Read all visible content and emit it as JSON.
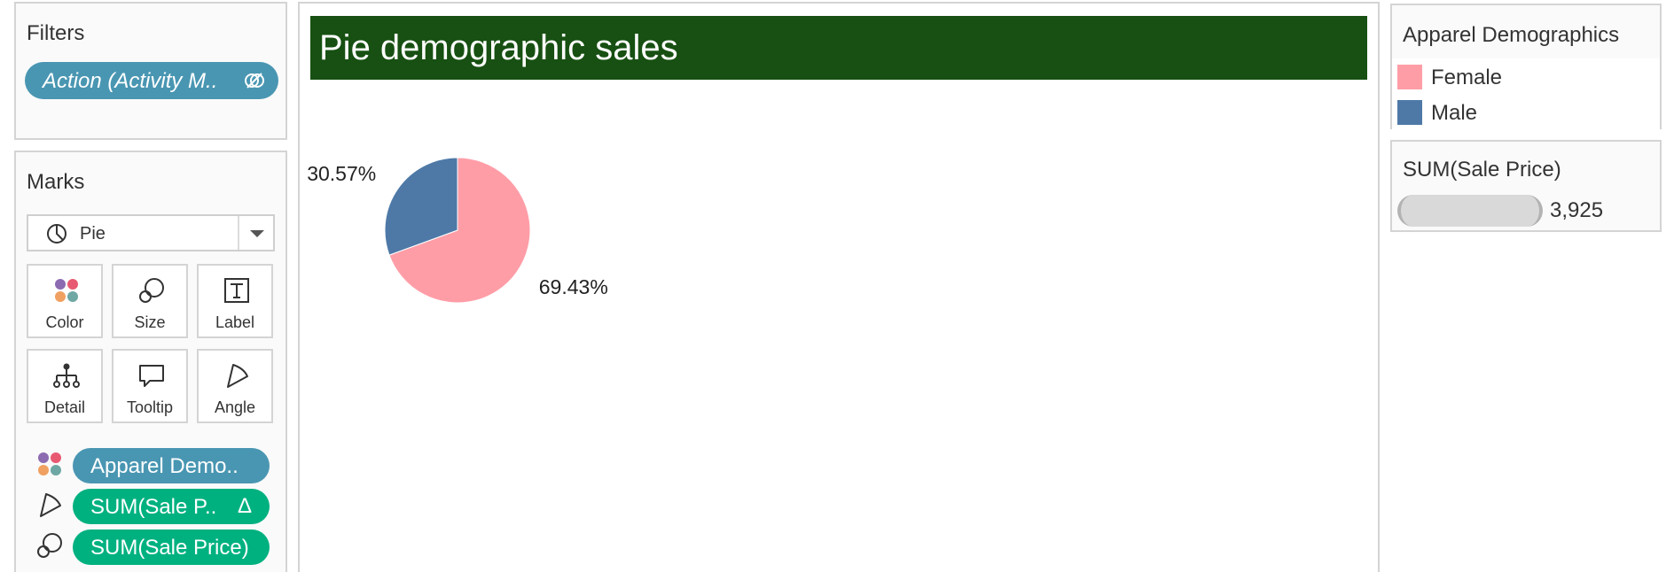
{
  "filters": {
    "title": "Filters",
    "pill_label": "Action (Activity M..",
    "pill_icon": "unlink-icon"
  },
  "marks": {
    "title": "Marks",
    "mark_type": "Pie",
    "buttons": [
      {
        "label": "Color",
        "icon": "color-icon"
      },
      {
        "label": "Size",
        "icon": "size-icon"
      },
      {
        "label": "Label",
        "icon": "label-icon"
      },
      {
        "label": "Detail",
        "icon": "detail-icon"
      },
      {
        "label": "Tooltip",
        "icon": "tooltip-icon"
      },
      {
        "label": "Angle",
        "icon": "angle-icon"
      }
    ],
    "shelf": [
      {
        "label": "Apparel Demo..",
        "icon": "color-icon",
        "color": "#4996b2"
      },
      {
        "label": "SUM(Sale P..",
        "icon": "angle-icon",
        "color": "#00b180",
        "suffix": "Δ"
      },
      {
        "label": "SUM(Sale Price)",
        "icon": "size-icon",
        "color": "#00b180"
      }
    ]
  },
  "view": {
    "title": "Pie demographic sales",
    "title_bg": "#175012"
  },
  "chart_data": {
    "type": "pie",
    "categories": [
      "Female",
      "Male"
    ],
    "values": [
      69.43,
      30.57
    ],
    "labels": [
      "69.43%",
      "30.57%"
    ],
    "colors": [
      "#ff9da7",
      "#4e79a7"
    ]
  },
  "legend_color": {
    "title": "Apparel Demographics",
    "items": [
      {
        "label": "Female",
        "color": "#ff9da7"
      },
      {
        "label": "Male",
        "color": "#4e79a7"
      }
    ]
  },
  "legend_size": {
    "title": "SUM(Sale Price)",
    "value": "3,925"
  }
}
